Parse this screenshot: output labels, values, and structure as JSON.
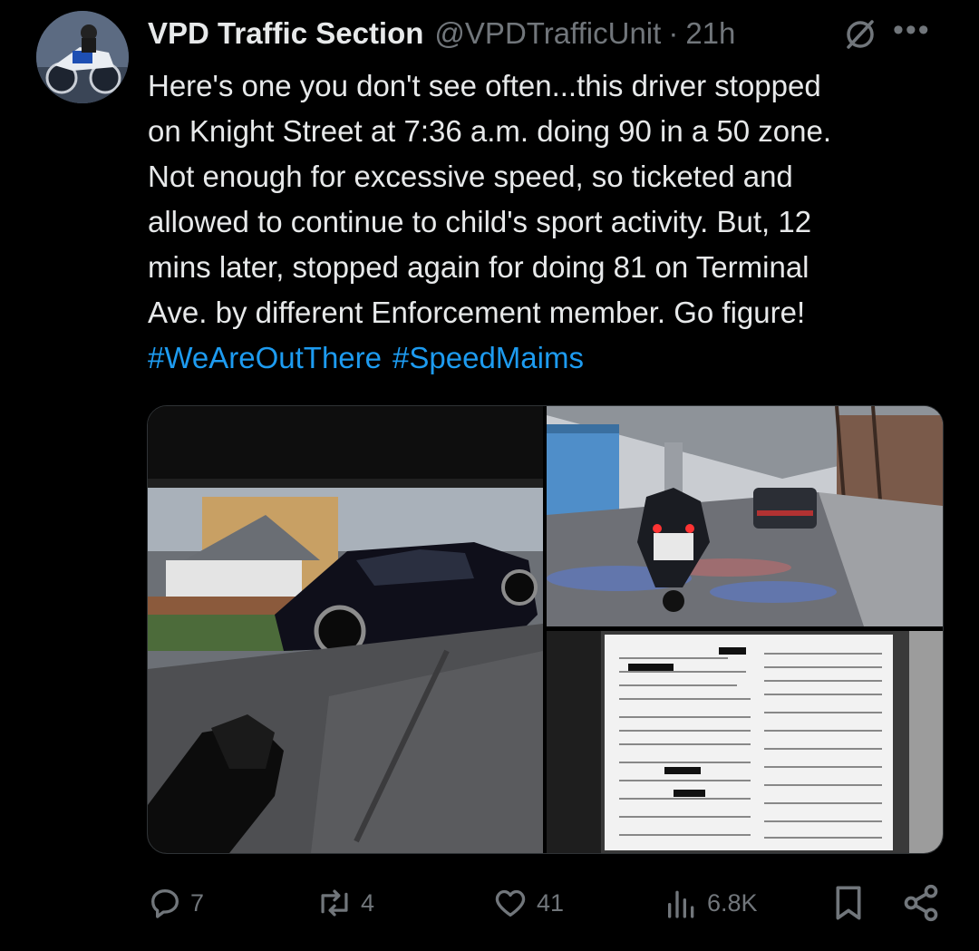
{
  "author": {
    "name": "VPD Traffic Section",
    "handle": "@VPDTrafficUnit",
    "separator": "·",
    "time": "21h",
    "more_label": "•••"
  },
  "tweet": {
    "lines": [
      "Here's one you don't see often...this driver stopped",
      "on Knight Street at 7:36 a.m. doing 90 in a 50 zone.",
      "Not enough for excessive speed, so ticketed and",
      "allowed to continue to child's sport activity. But, 12",
      "mins later, stopped again for doing 81 on Terminal",
      "Ave. by different Enforcement member. Go figure!"
    ],
    "hashtags": [
      "#WeAreOutThere",
      "#SpeedMaims"
    ]
  },
  "stats": {
    "replies": "7",
    "reposts": "4",
    "likes": "41",
    "views": "6.8K"
  },
  "colors": {
    "background": "#000000",
    "text": "#e7e9ea",
    "muted": "#71767b",
    "accent": "#1d9bf0"
  },
  "icons": {
    "grok": "grok-icon",
    "reply": "reply-icon",
    "repost": "repost-icon",
    "like": "heart-icon",
    "views": "views-icon",
    "bookmark": "bookmark-icon",
    "share": "share-icon"
  }
}
